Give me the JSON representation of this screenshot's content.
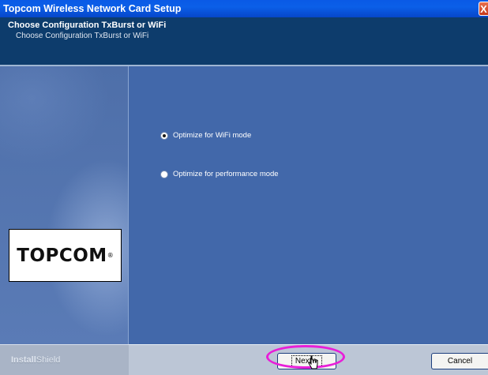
{
  "window": {
    "title": "Topcom Wireless Network Card Setup",
    "close_glyph": "X"
  },
  "header": {
    "title": "Choose Configuration TxBurst or WiFi",
    "subtitle": "Choose Configuration TxBurst or WiFi"
  },
  "branding": {
    "logo": "TOPCOM",
    "logo_mark": "®"
  },
  "options": [
    {
      "label": "Optimize for WiFi mode",
      "checked": true
    },
    {
      "label": "Optimize for performance mode",
      "checked": false
    }
  ],
  "footer": {
    "installshield_bold": "Install",
    "installshield_light": "Shield",
    "next_label": "Next >",
    "cancel_label": "Cancel"
  },
  "colors": {
    "title_bar": "#0b5fe8",
    "header_bg": "#0d3c6c",
    "panel_bg": "#4268aa",
    "highlight": "#e81ed8"
  }
}
